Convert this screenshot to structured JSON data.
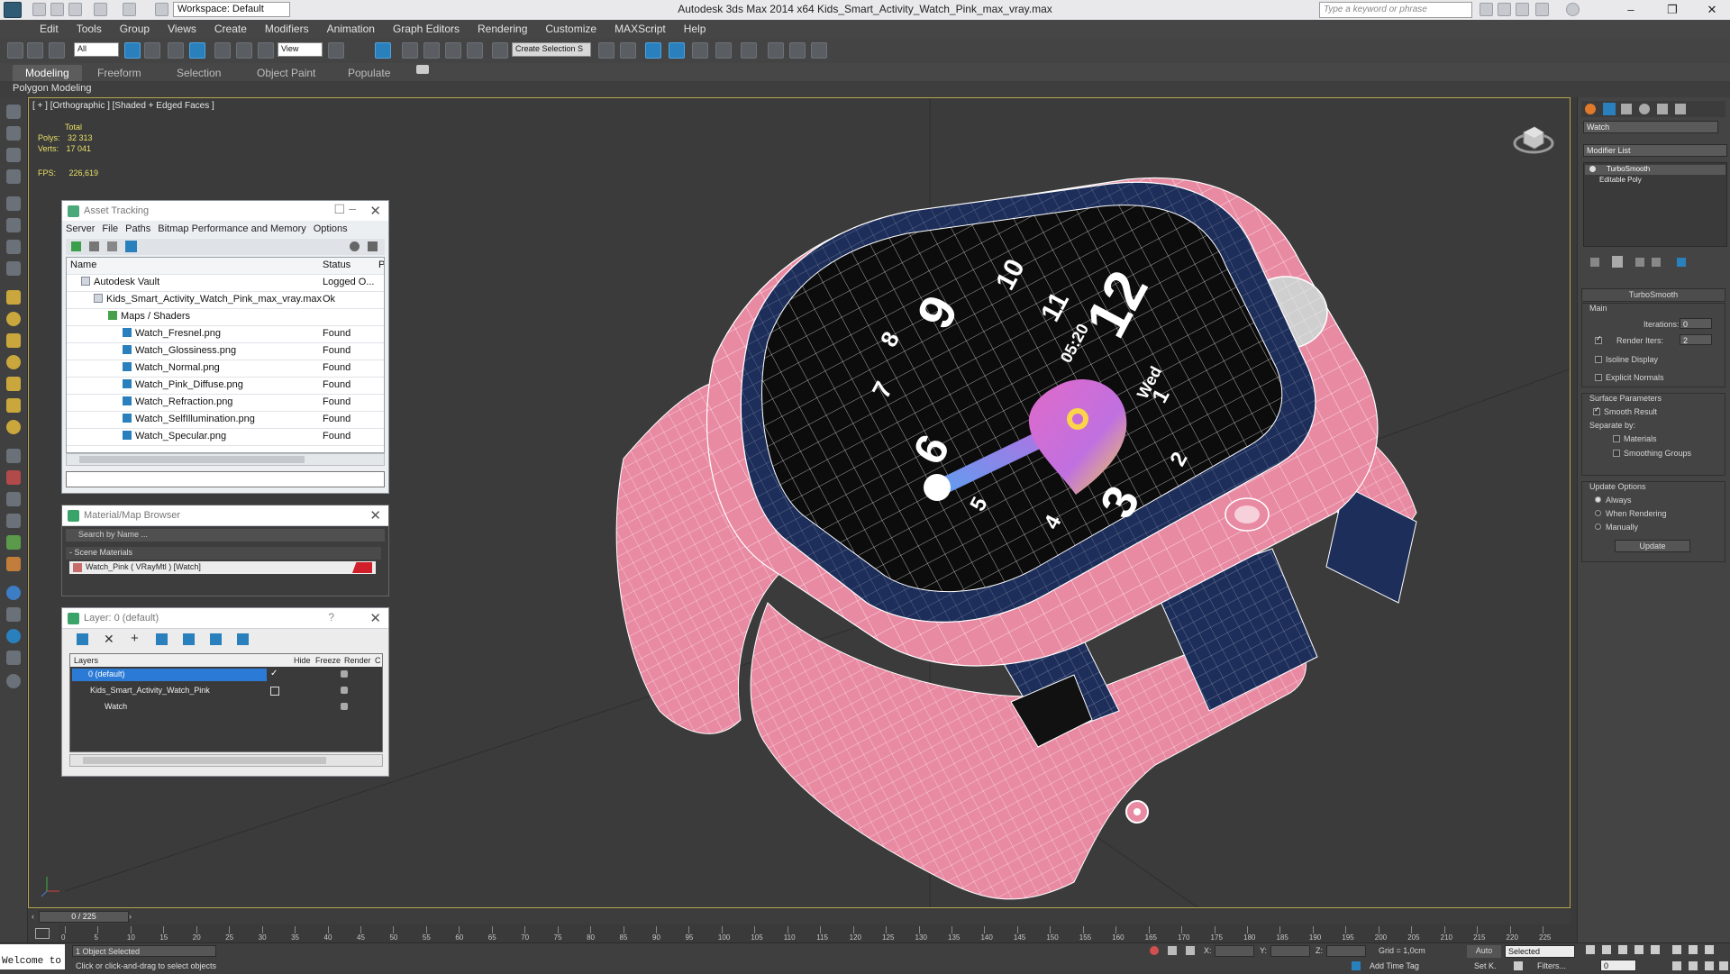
{
  "window": {
    "title": "Autodesk 3ds Max  2014 x64     Kids_Smart_Activity_Watch_Pink_max_vray.max",
    "workspace": "Workspace: Default",
    "search_placeholder": "Type a keyword or phrase"
  },
  "menu": [
    "Edit",
    "Tools",
    "Group",
    "Views",
    "Create",
    "Modifiers",
    "Animation",
    "Graph Editors",
    "Rendering",
    "Customize",
    "MAXScript",
    "Help"
  ],
  "toolbar": {
    "filter": "All",
    "view": "View",
    "selection_set": "Create Selection S"
  },
  "ribbon": {
    "tabs": [
      "Modeling",
      "Freeform",
      "Selection",
      "Object Paint",
      "Populate"
    ],
    "active_tab": "Modeling",
    "sub": "Polygon Modeling"
  },
  "viewport": {
    "label": "[ + ] [Orthographic ] [Shaded + Edged Faces ]",
    "stats_total": "Total",
    "polys_label": "Polys:",
    "polys": "32 313",
    "verts_label": "Verts:",
    "verts": "17 041",
    "fps_label": "FPS:",
    "fps": "226,619",
    "watch_time": "05:20",
    "watch_day": "Wed"
  },
  "asset_tracking": {
    "title": "Asset Tracking",
    "menu": [
      "Server",
      "File",
      "Paths",
      "Bitmap Performance and Memory",
      "Options"
    ],
    "col_name": "Name",
    "col_status": "Status",
    "col_extra": "P",
    "rows": [
      {
        "name": "Autodesk Vault",
        "status": "Logged O..."
      },
      {
        "name": "Kids_Smart_Activity_Watch_Pink_max_vray.max",
        "status": "Ok"
      },
      {
        "name": "Maps / Shaders",
        "status": ""
      },
      {
        "name": "Watch_Fresnel.png",
        "status": "Found"
      },
      {
        "name": "Watch_Glossiness.png",
        "status": "Found"
      },
      {
        "name": "Watch_Normal.png",
        "status": "Found"
      },
      {
        "name": "Watch_Pink_Diffuse.png",
        "status": "Found"
      },
      {
        "name": "Watch_Refraction.png",
        "status": "Found"
      },
      {
        "name": "Watch_SelfIllumination.png",
        "status": "Found"
      },
      {
        "name": "Watch_Specular.png",
        "status": "Found"
      }
    ]
  },
  "material_browser": {
    "title": "Material/Map Browser",
    "search": "Search by Name ...",
    "section": "- Scene Materials",
    "material": "Watch_Pink  ( VRayMtl )  [Watch]",
    "swatch_color": "#d01f2a"
  },
  "layer_panel": {
    "title": "Layer: 0 (default)",
    "help": "?",
    "cols": [
      "Layers",
      "Hide",
      "Freeze",
      "Render",
      "C"
    ],
    "rows": [
      "0 (default)",
      "Kids_Smart_Activity_Watch_Pink",
      "Watch"
    ]
  },
  "command_panel": {
    "object_name": "Watch",
    "modifier_list": "Modifier List",
    "stack": [
      "TurboSmooth",
      "Editable Poly"
    ],
    "rollout": "TurboSmooth",
    "main": "Main",
    "iterations_label": "Iterations:",
    "iterations": "0",
    "render_iters_label": "Render Iters:",
    "render_iters": "2",
    "isoline": "Isoline Display",
    "explicit": "Explicit Normals",
    "surface": "Surface Parameters",
    "smooth_result": "Smooth Result",
    "separate_by": "Separate by:",
    "materials": "Materials",
    "smoothing_groups": "Smoothing Groups",
    "update_options": "Update Options",
    "always": "Always",
    "when_rendering": "When Rendering",
    "manually": "Manually",
    "update_btn": "Update"
  },
  "timeline": {
    "frame": "0 / 225",
    "ticks": [
      "0",
      "5",
      "10",
      "15",
      "20",
      "25",
      "30",
      "35",
      "40",
      "45",
      "50",
      "55",
      "60",
      "65",
      "70",
      "75",
      "80",
      "85",
      "90",
      "95",
      "100",
      "105",
      "110",
      "115",
      "120",
      "125",
      "130",
      "135",
      "140",
      "145",
      "150",
      "155",
      "160",
      "165",
      "170",
      "175",
      "180",
      "185",
      "190",
      "195",
      "200",
      "205",
      "210",
      "215",
      "220",
      "225"
    ]
  },
  "status": {
    "welcome": "Welcome to",
    "selected": "1 Object Selected",
    "hint": "Click or click-and-drag to select objects",
    "x_label": "X:",
    "y_label": "Y:",
    "z_label": "Z:",
    "grid": "Grid = 1,0cm",
    "add_time_tag": "Add Time Tag",
    "auto": "Auto",
    "selected_dd": "Selected",
    "setk": "Set K.",
    "filters": "Filters...",
    "frame_field": "0"
  },
  "colors": {
    "strap_pink": "#e98aa3",
    "navy": "#1d2e5a",
    "accent": "#2a7fbd"
  }
}
